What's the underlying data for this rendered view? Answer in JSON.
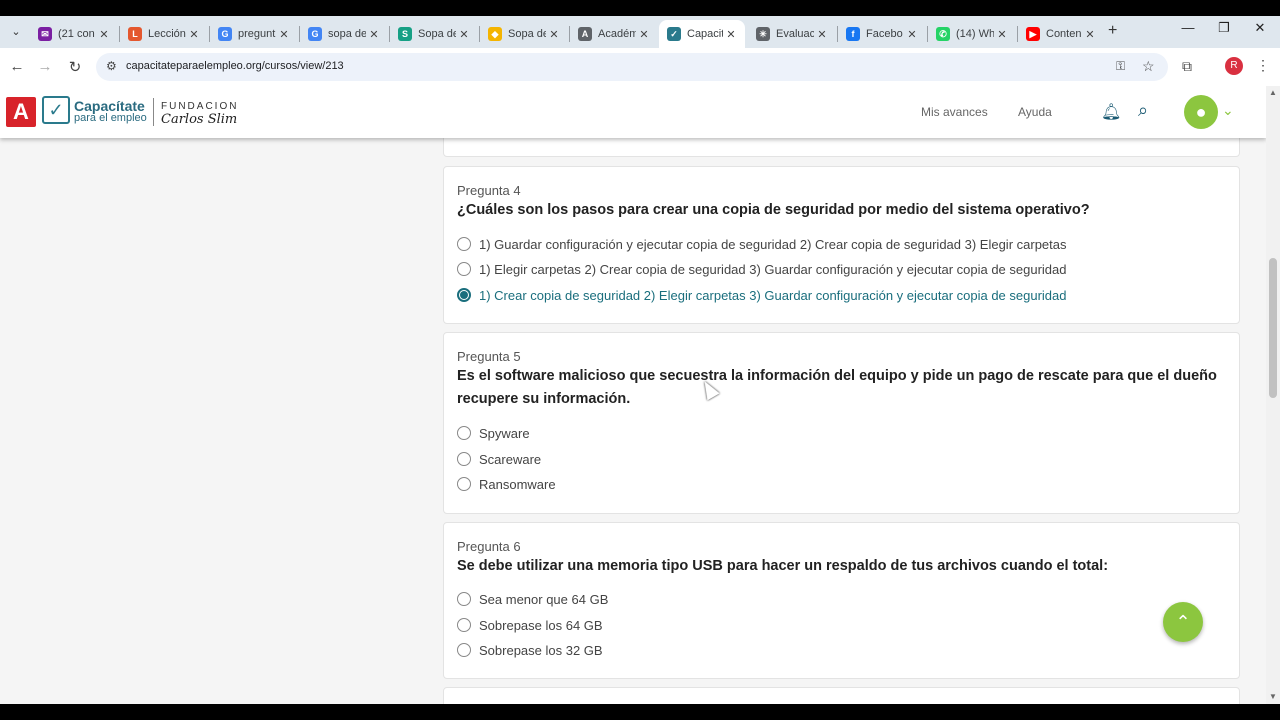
{
  "browser": {
    "tabs": [
      {
        "label": "(21 con",
        "fav_color": "#7b1fa2",
        "fav_glyph": "✉"
      },
      {
        "label": "Lección",
        "fav_color": "#e4572e",
        "fav_glyph": "L"
      },
      {
        "label": "pregunt",
        "fav_color": "#4285f4",
        "fav_glyph": "G"
      },
      {
        "label": "sopa de",
        "fav_color": "#4285f4",
        "fav_glyph": "G"
      },
      {
        "label": "Sopa de",
        "fav_color": "#16a085",
        "fav_glyph": "S"
      },
      {
        "label": "Sopa de",
        "fav_color": "#f4b400",
        "fav_glyph": "◆"
      },
      {
        "label": "Académ",
        "fav_color": "#5f6368",
        "fav_glyph": "A"
      },
      {
        "label": "Capacit",
        "fav_color": "#2a7a8c",
        "fav_glyph": "✓"
      },
      {
        "label": "Evaluac",
        "fav_color": "#5f6368",
        "fav_glyph": "✳"
      },
      {
        "label": "Facebo",
        "fav_color": "#1877f2",
        "fav_glyph": "f"
      },
      {
        "label": "(14) Wh",
        "fav_color": "#25d366",
        "fav_glyph": "✆"
      },
      {
        "label": "Conten",
        "fav_color": "#ff0000",
        "fav_glyph": "▶"
      }
    ],
    "url": "capacitateparaelempleo.org/cursos/view/213",
    "profile_initial": "R"
  },
  "site": {
    "logo_a": "A",
    "logo_line1": "Capacítate",
    "logo_line2": "para el empleo",
    "foundation_line1": "FUNDACION",
    "foundation_line2": "Carlos Slim",
    "nav_progress": "Mis avances",
    "nav_help": "Ayuda"
  },
  "questions": [
    {
      "label": "Pregunta 4",
      "text": "¿Cuáles son los pasos para crear una copia de seguridad por medio del sistema operativo?",
      "options": [
        "1) Guardar configuración y ejecutar copia de seguridad 2) Crear copia de seguridad 3) Elegir carpetas",
        "1) Elegir carpetas 2) Crear copia de seguridad 3) Guardar configuración y ejecutar copia de seguridad",
        "1) Crear copia de seguridad 2) Elegir carpetas 3) Guardar configuración y ejecutar copia de seguridad"
      ],
      "selected": 2
    },
    {
      "label": "Pregunta 5",
      "text": "Es el software malicioso que secuestra la información del equipo y pide un pago de rescate para que el dueño recupere su información.",
      "options": [
        "Spyware",
        "Scareware",
        "Ransomware"
      ],
      "selected": -1
    },
    {
      "label": "Pregunta 6",
      "text": "Se debe utilizar una memoria tipo USB para hacer un respaldo de tus archivos cuando el total:",
      "options": [
        "Sea menor que 64 GB",
        "Sobrepase los 64 GB",
        "Sobrepase los 32 GB"
      ],
      "selected": -1
    }
  ],
  "icons": {
    "scroll_top": "chevrons-up-icon",
    "bell": "bell-icon",
    "search": "search-icon",
    "avatar": "user-icon"
  }
}
